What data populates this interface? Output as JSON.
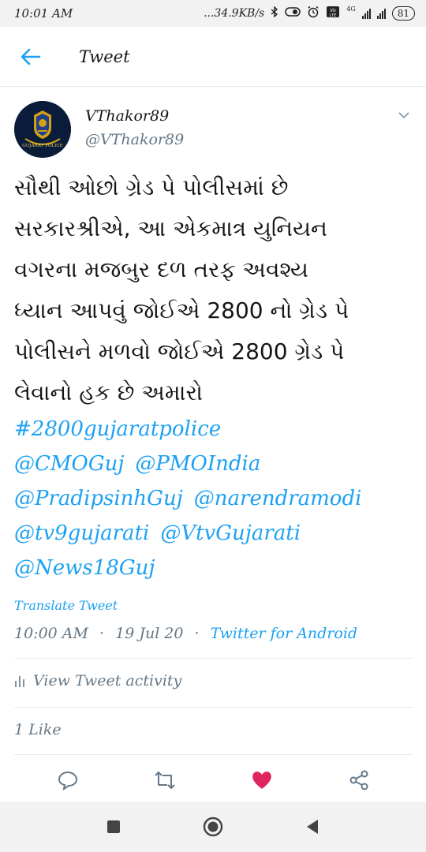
{
  "status_bar": {
    "time": "10:01 AM",
    "network_speed": "...34.9KB/s",
    "network_type": "4G",
    "battery": "81"
  },
  "header": {
    "title": "Tweet"
  },
  "tweet": {
    "display_name": "VThakor89",
    "handle": "@VThakor89",
    "avatar_text": "GUJARAT POLICE",
    "text_lines": [
      "સૌથી ઓછો  ગ્રેડ પે પોલીસમાં છે",
      "સરકારશ્રીએ, આ એકમાત્ર યુનિયન",
      "વગરના મજબુર દળ તરફ અવશ્ય",
      "ધ્યાન આપવું જોઈએ 2800 નો ગ્રેડ પે",
      "પોલીસને મળવો જોઈએ 2800 ગ્રેડ પે",
      "લેવાનો હક છે અમારો"
    ],
    "hashtag": "#2800gujaratpolice",
    "mentions": [
      "@CMOGuj",
      "@PMOIndia",
      "@PradipsinhGuj",
      "@narendramodi",
      "@tv9gujarati",
      "@VtvGujarati",
      "@News18Guj"
    ],
    "translate_label": "Translate Tweet",
    "time": "10:00 AM",
    "date": "19 Jul 20",
    "separator": "·",
    "source": "Twitter for Android",
    "activity_label": "View Tweet activity",
    "likes_label": "1 Like"
  },
  "icons": {
    "back": "arrow-left-icon",
    "reply": "reply-icon",
    "retweet": "retweet-icon",
    "like": "heart-icon",
    "share": "share-icon",
    "caret": "chevron-down-icon"
  },
  "colors": {
    "link": "#1da1f2",
    "like": "#e0245e",
    "muted": "#657786"
  }
}
